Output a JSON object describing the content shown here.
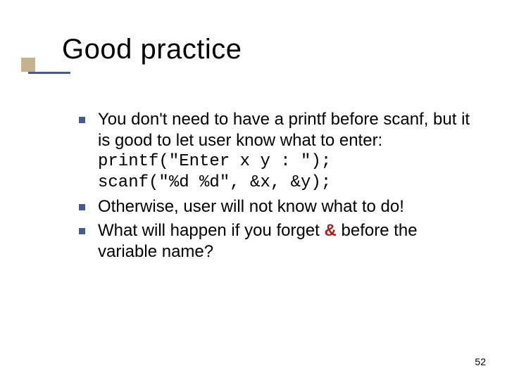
{
  "title": "Good practice",
  "bullets": [
    {
      "text": "You don't need to have a printf before scanf, but it is good to let user know what to enter:",
      "code1": "printf(\"Enter x y : \");",
      "code2": "scanf(\"%d %d\", &x, &y);"
    },
    {
      "text": "Otherwise, user will not know what to do!"
    },
    {
      "text_before_amp": "What will happen if you forget ",
      "amp": "&",
      "text_after_amp": " before the variable name?"
    }
  ],
  "page_number": "52"
}
